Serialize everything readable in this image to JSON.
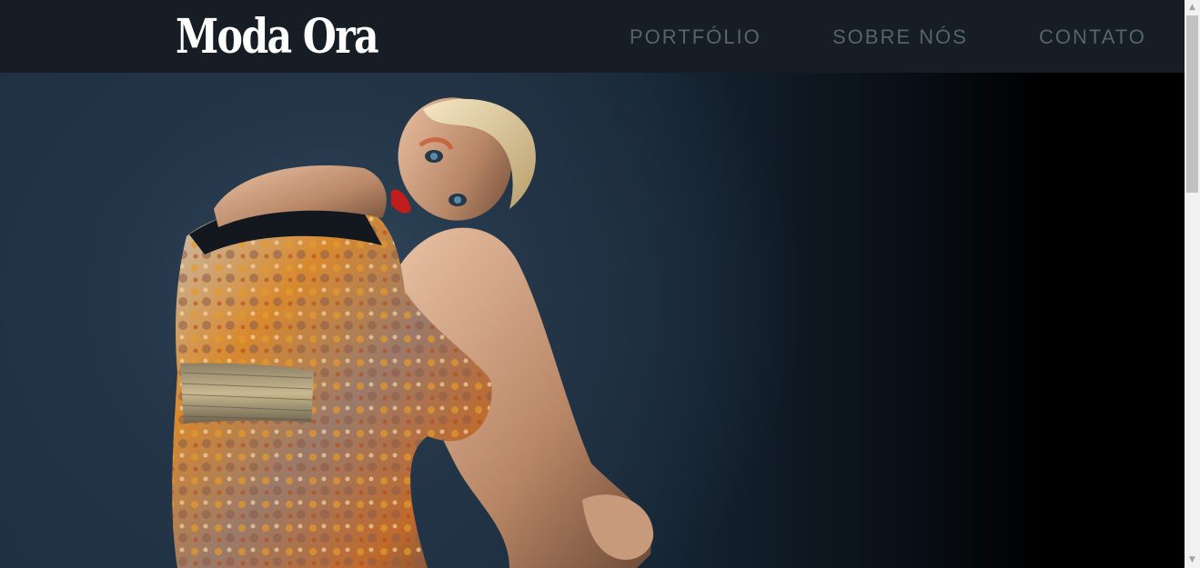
{
  "header": {
    "logo": "Moda Ora",
    "nav": [
      {
        "label": "PORTFÓLIO"
      },
      {
        "label": "SOBRE NÓS"
      },
      {
        "label": "CONTATO"
      }
    ]
  },
  "colors": {
    "header_bg": "#161d24",
    "nav_text": "#56646f",
    "logo_text": "#ffffff"
  },
  "hero": {
    "image": "fashion-model-photo"
  },
  "scrollbar": {
    "up_icon": "chevron-up-icon",
    "down_icon": "chevron-down-icon"
  }
}
